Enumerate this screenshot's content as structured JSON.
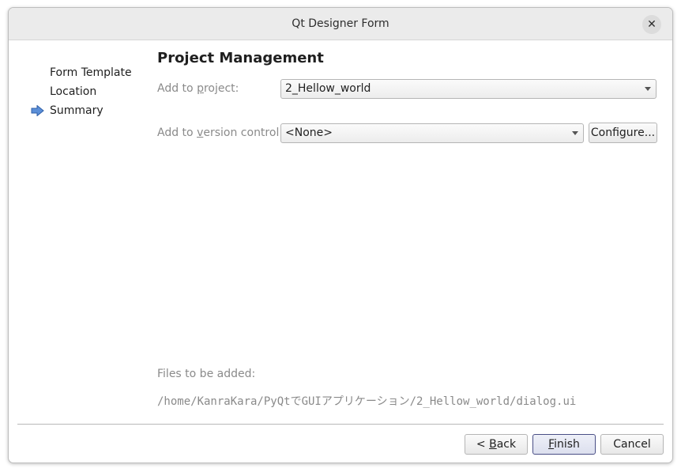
{
  "window": {
    "title": "Qt Designer Form",
    "close_glyph": "✕"
  },
  "steps": [
    {
      "label": "Form Template",
      "current": false
    },
    {
      "label": "Location",
      "current": false
    },
    {
      "label": "Summary",
      "current": true
    }
  ],
  "page": {
    "title": "Project Management",
    "project": {
      "label_pre": "Add to ",
      "label_mnemonic": "p",
      "label_post": "roject:",
      "value": "2_Hellow_world"
    },
    "version_control": {
      "label_pre": "Add to ",
      "label_mnemonic": "v",
      "label_post": "ersion control:",
      "value": "<None>",
      "configure_label": "Configure..."
    },
    "files_label": "Files to be added:",
    "files_path": "/home/KanraKara/PyQtでGUIアプリケーション/2_Hellow_world/dialog.ui"
  },
  "buttons": {
    "back": {
      "pre": "< ",
      "mnemonic": "B",
      "post": "ack"
    },
    "finish": {
      "pre": "",
      "mnemonic": "F",
      "post": "inish"
    },
    "cancel": "Cancel"
  },
  "colors": {
    "accent_arrow": "#5b8fd8",
    "primary_border": "#4a4f86"
  }
}
